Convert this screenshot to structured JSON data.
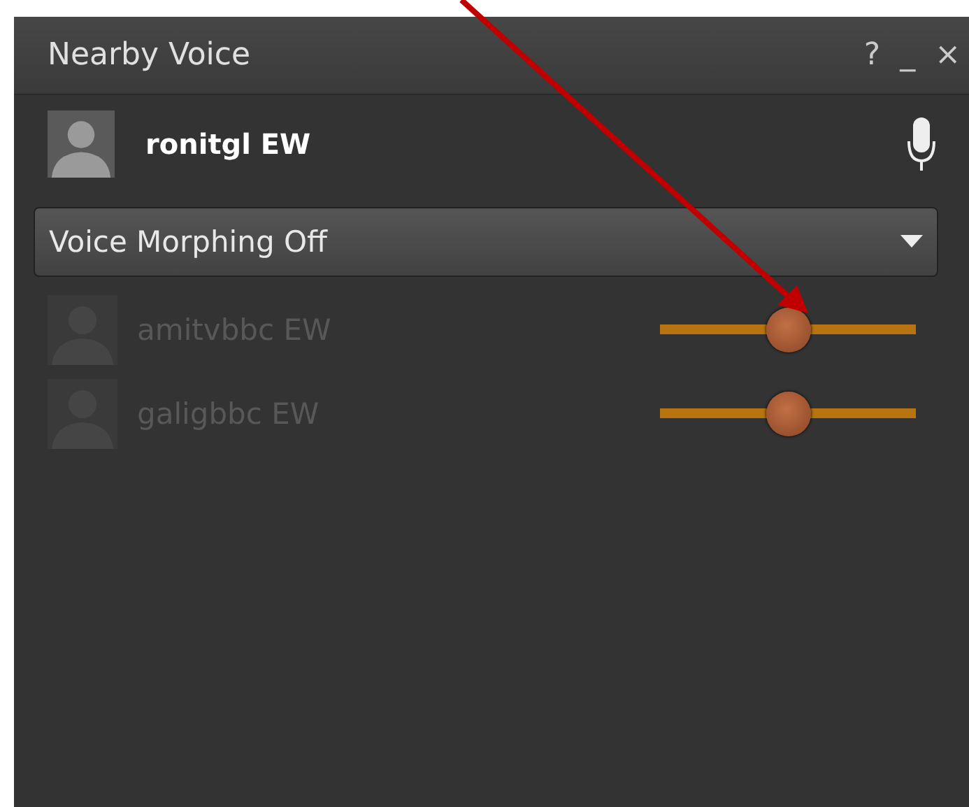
{
  "window": {
    "title": "Nearby Voice",
    "buttons": [
      "?",
      "_",
      "×"
    ]
  },
  "self": {
    "name": "ronitgl EW"
  },
  "voice_morphing": {
    "value": "Voice Morphing Off"
  },
  "participants": [
    {
      "name": "amitvbbc EW",
      "disabled": true,
      "level": 0.5
    },
    {
      "name": "galigbbc EW",
      "disabled": true,
      "level": 0.5
    }
  ]
}
